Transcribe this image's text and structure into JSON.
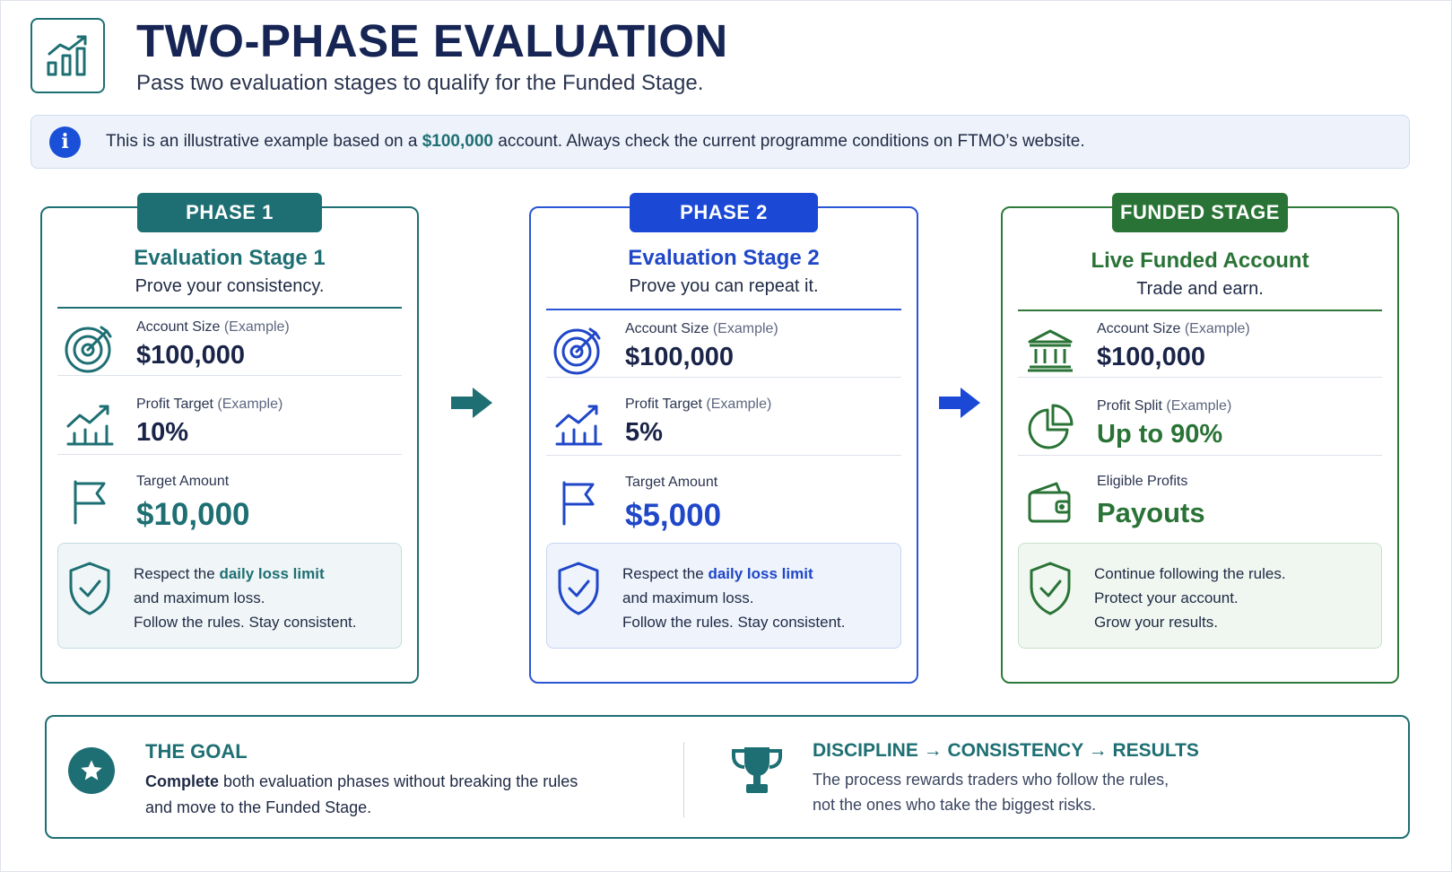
{
  "header": {
    "title": "TWO-PHASE EVALUATION",
    "subtitle": "Pass two evaluation stages to qualify for the Funded Stage.",
    "logo_icon": "chart-growth-icon"
  },
  "info": {
    "icon": "info-icon",
    "icon_glyph": "i",
    "text_before": "This is an illustrative example based on a ",
    "amount": "$100,000",
    "text_after": " account. Always check the current programme conditions on FTMO’s website."
  },
  "phases": [
    {
      "badge": "PHASE 1",
      "title": "Evaluation Stage 1",
      "subtitle": "Prove your consistency.",
      "color": "#1e6f73",
      "rows": [
        {
          "icon": "target-icon",
          "label": "Account Size",
          "example": " (Example)",
          "value": "$100,000"
        },
        {
          "icon": "chart-up-icon",
          "label": "Profit Target",
          "example": " (Example)",
          "value": "10%"
        },
        {
          "icon": "flag-icon",
          "label": "Target Amount",
          "example": "",
          "value": "$10,000"
        }
      ],
      "note": {
        "icon": "shield-check-icon",
        "line1_before": "Respect the ",
        "line1_highlight": "daily loss limit",
        "line2": "and maximum loss.",
        "line3": "Follow the rules. Stay consistent."
      }
    },
    {
      "badge": "PHASE 2",
      "title": "Evaluation Stage 2",
      "subtitle": "Prove you can repeat it.",
      "color": "#1f47c8",
      "rows": [
        {
          "icon": "target-icon",
          "label": "Account Size",
          "example": " (Example)",
          "value": "$100,000"
        },
        {
          "icon": "chart-up-icon",
          "label": "Profit Target",
          "example": " (Example)",
          "value": "5%"
        },
        {
          "icon": "flag-icon",
          "label": "Target Amount",
          "example": "",
          "value": "$5,000"
        }
      ],
      "note": {
        "icon": "shield-check-icon",
        "line1_before": "Respect the ",
        "line1_highlight": "daily loss limit",
        "line2": "and maximum loss.",
        "line3": "Follow the rules. Stay consistent."
      }
    },
    {
      "badge": "FUNDED STAGE",
      "title": "Live Funded Account",
      "subtitle": "Trade and earn.",
      "color": "#2a7336",
      "rows": [
        {
          "icon": "bank-icon",
          "label": "Account Size",
          "example": " (Example)",
          "value": "$100,000"
        },
        {
          "icon": "pie-chart-icon",
          "label": "Profit Split",
          "example": " (Example)",
          "value": "Up to 90%"
        },
        {
          "icon": "wallet-icon",
          "label": "Eligible Profits",
          "example": "",
          "value": "Payouts"
        }
      ],
      "note": {
        "icon": "shield-check-icon",
        "line1": "Continue following the rules.",
        "line2": "Protect your account.",
        "line3": "Grow your results."
      }
    }
  ],
  "goal": {
    "icon": "star-icon",
    "title": "THE GOAL",
    "text_bold": "Complete",
    "text_rest": " both evaluation phases without breaking the rules",
    "text_line2": "and move to the Funded Stage."
  },
  "discipline": {
    "icon": "trophy-icon",
    "title": "DISCIPLINE → CONSISTENCY → RESULTS",
    "line1": "The process rewards traders who follow the rules,",
    "line2": "not the ones who take the biggest risks."
  }
}
